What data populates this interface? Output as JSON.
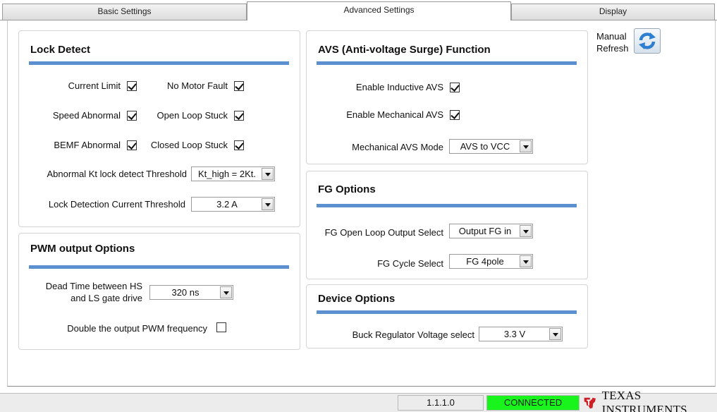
{
  "tabs": [
    {
      "label": "Basic Settings",
      "active": false
    },
    {
      "label": "Advanced Settings",
      "active": true
    },
    {
      "label": "Display",
      "active": false
    }
  ],
  "lock_detect": {
    "title": "Lock Detect",
    "current_limit": {
      "label": "Current Limit",
      "checked": true
    },
    "no_motor_fault": {
      "label": "No Motor Fault",
      "checked": true
    },
    "speed_abnormal": {
      "label": "Speed Abnormal",
      "checked": true
    },
    "open_loop_stuck": {
      "label": "Open Loop Stuck",
      "checked": true
    },
    "bemf_abnormal": {
      "label": "BEMF Abnormal",
      "checked": true
    },
    "closed_loop_stuck": {
      "label": "Closed Loop Stuck",
      "checked": true
    },
    "kt_threshold": {
      "label": "Abnormal Kt lock detect Threshold",
      "value": "Kt_high = 2Kt."
    },
    "current_threshold": {
      "label": "Lock Detection Current Threshold",
      "value": "3.2 A"
    }
  },
  "pwm_output": {
    "title": "PWM output Options",
    "dead_time": {
      "label_line1": "Dead Time between HS",
      "label_line2": "and LS gate drive",
      "value": "320 ns"
    },
    "double_pwm": {
      "label": "Double the output PWM frequency",
      "checked": false
    }
  },
  "avs": {
    "title": "AVS (Anti-voltage Surge) Function",
    "enable_inductive": {
      "label": "Enable Inductive AVS",
      "checked": true
    },
    "enable_mechanical": {
      "label": "Enable Mechanical AVS",
      "checked": true
    },
    "mechanical_mode": {
      "label": "Mechanical AVS Mode",
      "value": "AVS to VCC"
    }
  },
  "fg_options": {
    "title": "FG Options",
    "open_loop_output": {
      "label": "FG Open Loop Output Select",
      "value": "Output FG in"
    },
    "cycle_select": {
      "label": "FG Cycle Select",
      "value": "FG 4pole"
    }
  },
  "device_options": {
    "title": "Device Options",
    "buck_voltage": {
      "label": "Buck Regulator Voltage select",
      "value": "3.3 V"
    }
  },
  "refresh": {
    "line1": "Manual",
    "line2": "Refresh",
    "icon": "refresh-icon"
  },
  "status": {
    "version": "1.1.1.0",
    "connection": "CONNECTED",
    "brand": "Texas Instruments",
    "brand_display": "TEXAS INSTRUMENTS"
  },
  "colors": {
    "accent_rule": "#5b8fd0",
    "connected": "#19f51c",
    "ti_red": "#cc1f26"
  }
}
